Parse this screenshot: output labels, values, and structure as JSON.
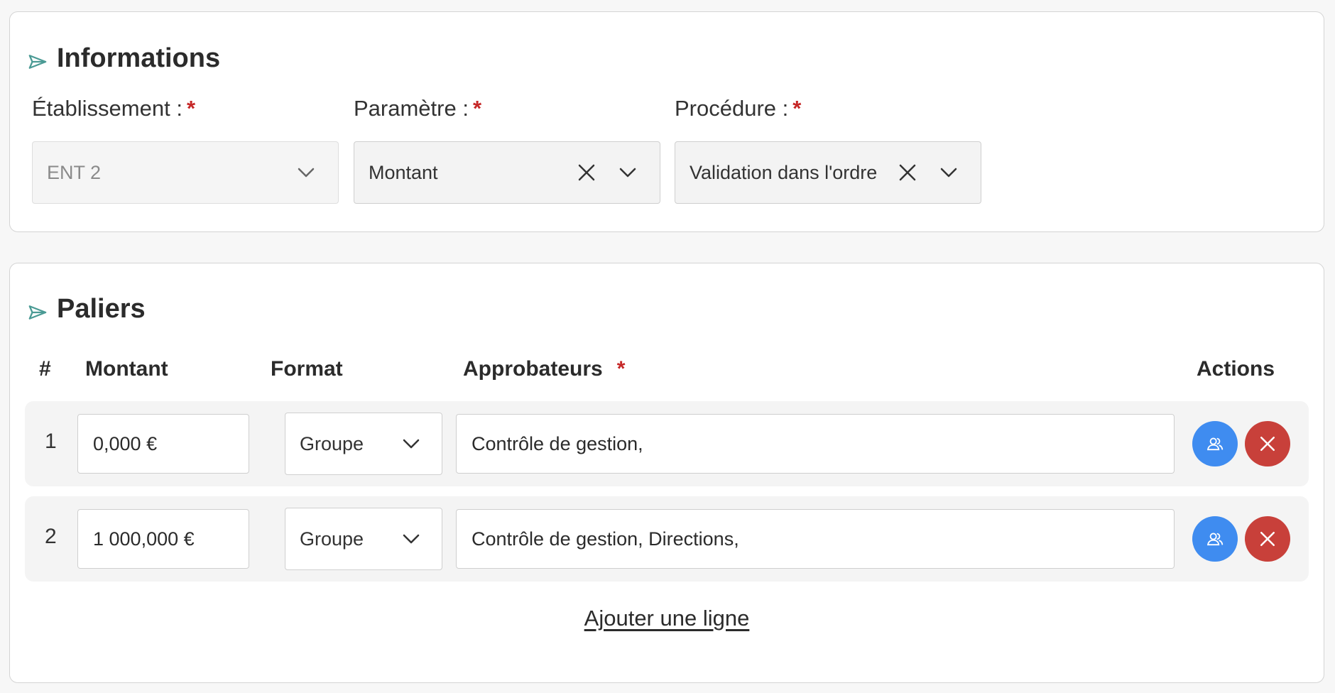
{
  "informations": {
    "title": "Informations",
    "fields": {
      "etablissement": {
        "label": "Établissement :",
        "required": "*",
        "value": "ENT 2"
      },
      "parametre": {
        "label": "Paramètre :",
        "required": "*",
        "value": "Montant"
      },
      "procedure": {
        "label": "Procédure :",
        "required": "*",
        "value": "Validation dans l'ordre"
      }
    }
  },
  "paliers": {
    "title": "Paliers",
    "columns": {
      "number": "#",
      "amount": "Montant",
      "format": "Format",
      "approvers": "Approbateurs",
      "approvers_required": "*",
      "actions": "Actions"
    },
    "rows": [
      {
        "number": "1",
        "amount": "0,000 €",
        "format": "Groupe",
        "approvers": "Contrôle de gestion,"
      },
      {
        "number": "2",
        "amount": "1 000,000 €",
        "format": "Groupe",
        "approvers": "Contrôle de gestion, Directions,"
      }
    ],
    "add_line": "Ajouter une ligne"
  },
  "icons": {
    "section": "send-icon",
    "clear": "close-icon",
    "dropdown": "chevron-down-icon",
    "users": "users-icon",
    "delete": "close-icon"
  },
  "colors": {
    "accent_icon": "#4a9a94",
    "required": "#c62828",
    "users_button": "#3f8cf0",
    "delete_button": "#c8403a"
  }
}
